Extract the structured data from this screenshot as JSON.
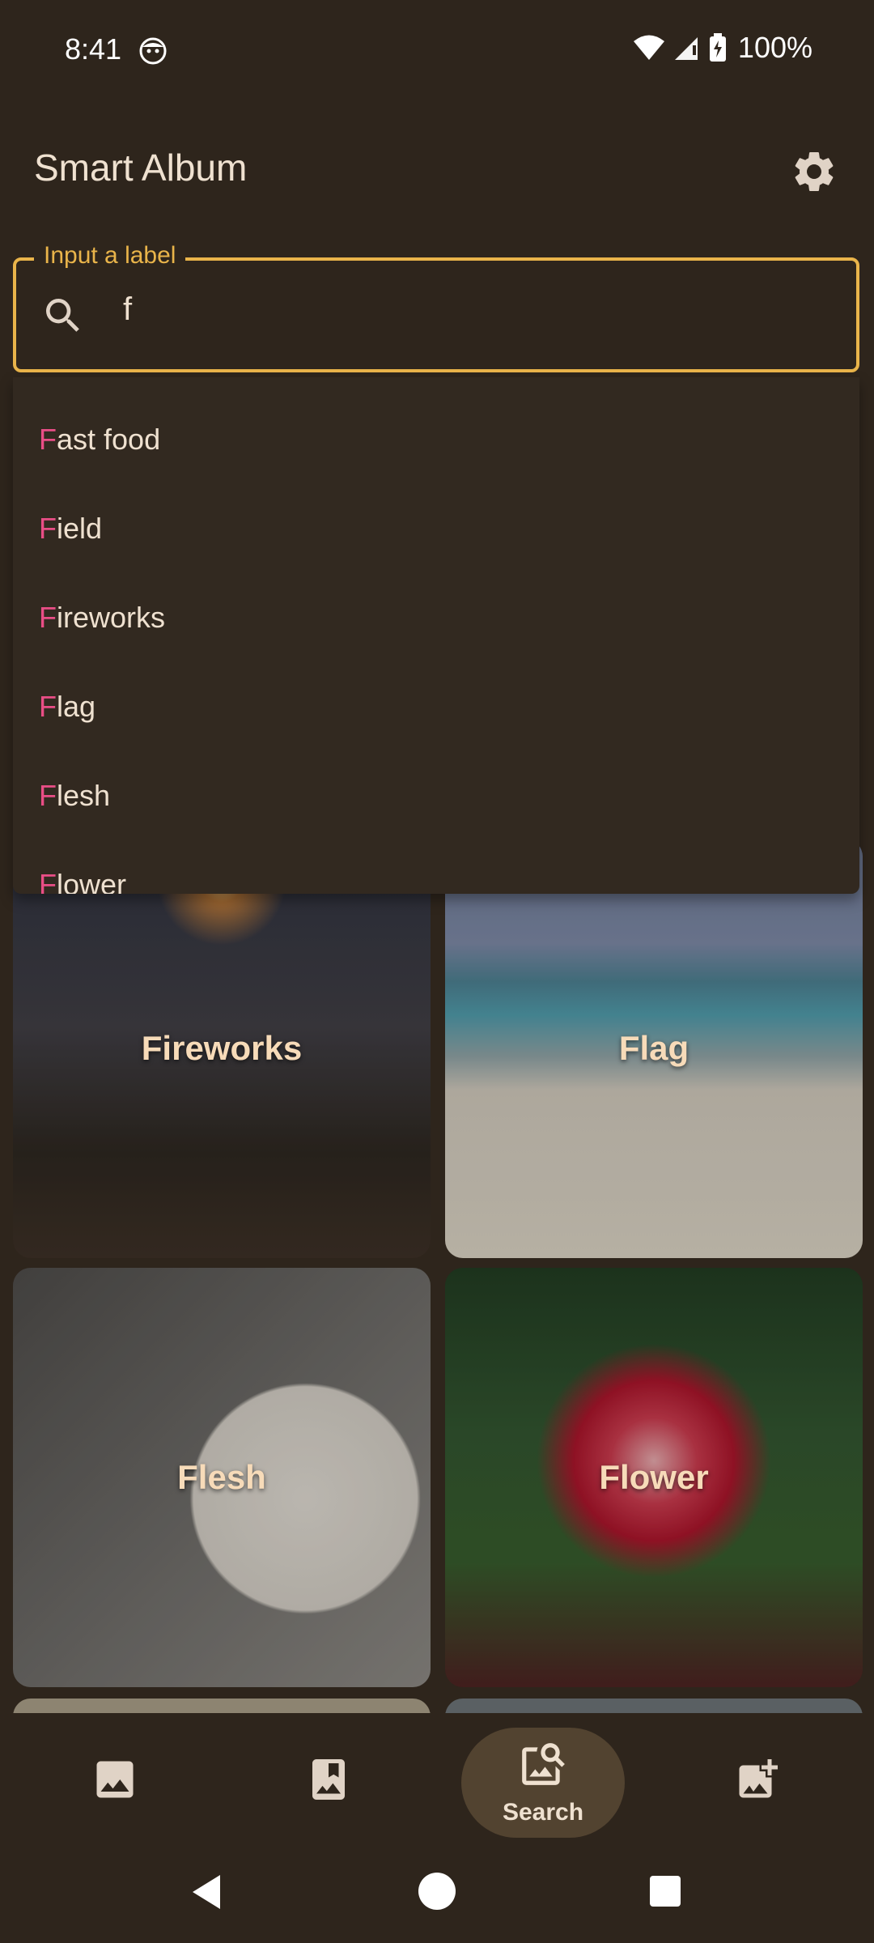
{
  "status_bar": {
    "time": "8:41",
    "battery": "100%"
  },
  "app": {
    "title": "Smart Album"
  },
  "search": {
    "label": "Input a label",
    "value": "f"
  },
  "suggestions": [
    {
      "first": "F",
      "rest": "ast food"
    },
    {
      "first": "F",
      "rest": "ield"
    },
    {
      "first": "F",
      "rest": "ireworks"
    },
    {
      "first": "F",
      "rest": "lag"
    },
    {
      "first": "F",
      "rest": "lesh"
    },
    {
      "first": "F",
      "rest": "lower"
    }
  ],
  "tiles": [
    {
      "label": "Fireworks"
    },
    {
      "label": "Flag"
    },
    {
      "label": "Flesh"
    },
    {
      "label": "Flower"
    }
  ],
  "bottom_nav": {
    "active_label": "Search",
    "items": [
      "photos-icon",
      "albums-icon",
      "search-icon",
      "add-photo-icon"
    ]
  },
  "colors": {
    "background": "#2e251c",
    "accent": "#e9b44a",
    "highlight": "#e94e86",
    "text": "#efe1d0"
  }
}
